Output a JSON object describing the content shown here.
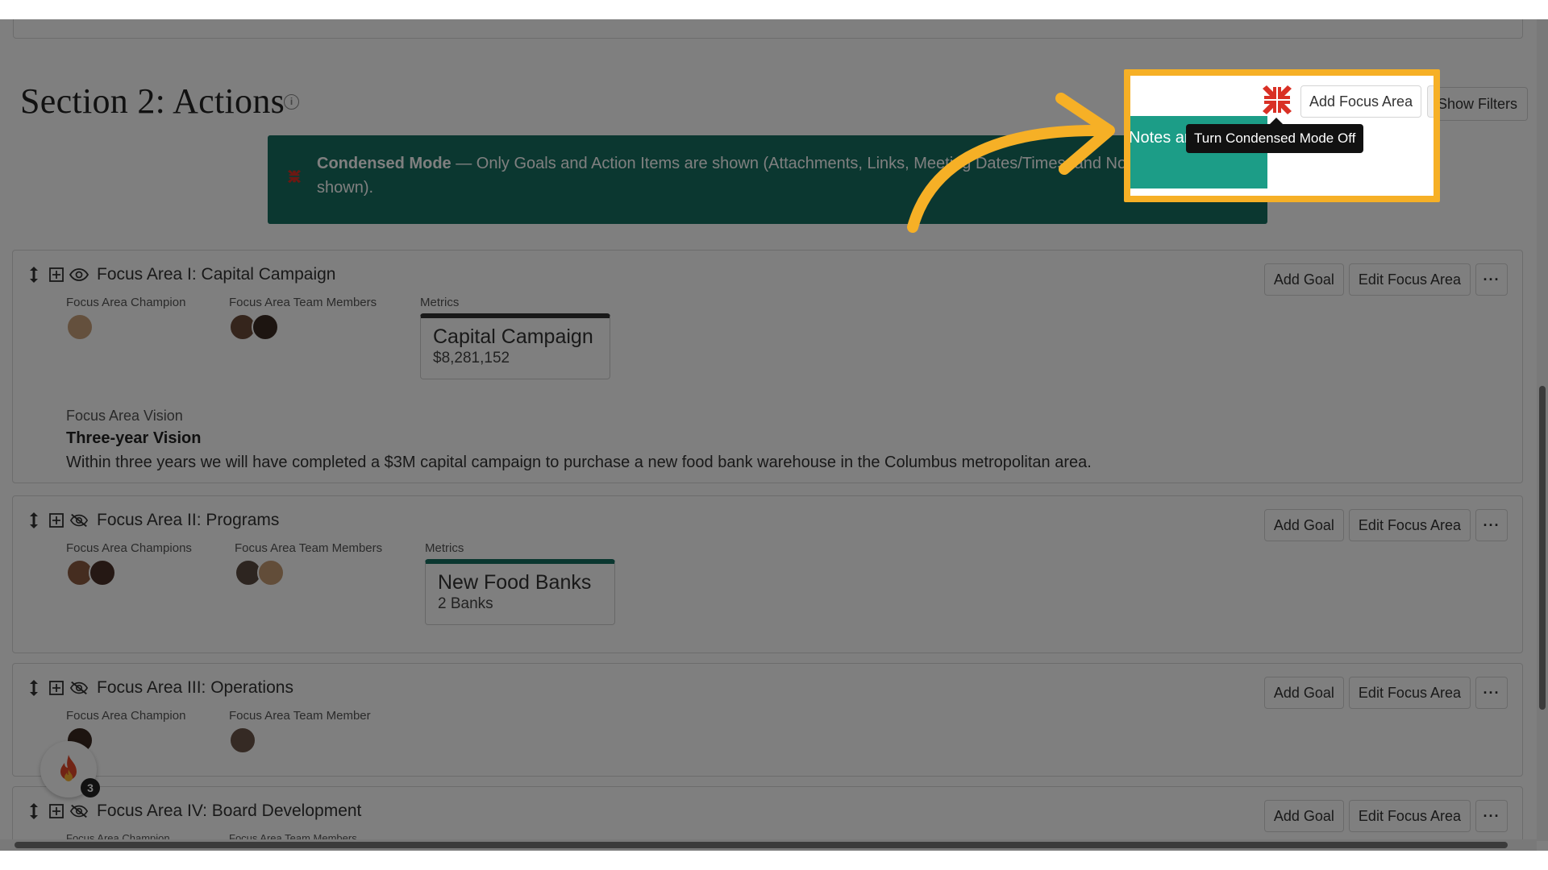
{
  "section": {
    "title": "Section 2: Actions",
    "info_icon": "info-icon"
  },
  "banner": {
    "heading": "Condensed Mode",
    "text": " — Only Goals and Action Items are shown (Attachments, Links, Meeting Dates/Times, and Notes are not shown).",
    "spot_text": "Notes are not"
  },
  "toolbar": {
    "add_focus_area": "Add Focus Area",
    "show_filters": "Show Filters",
    "condensed_toggle_icon": "compress-icon",
    "tooltip": "Turn Condensed Mode Off"
  },
  "focus_areas": [
    {
      "title": "Focus Area I: Capital Campaign",
      "champion_label": "Focus Area Champion",
      "team_label": "Focus Area Team Members",
      "metrics_label": "Metrics",
      "metric_name": "Capital Campaign",
      "metric_value": "$8,281,152",
      "vision_label": "Focus Area Vision",
      "vision_title": "Three-year Vision",
      "vision_text": "Within three years we will have completed a $3M capital campaign to purchase a new food bank warehouse in the Columbus metropolitan area.",
      "visible_icon": "eye-icon"
    },
    {
      "title": "Focus Area II: Programs",
      "champion_label": "Focus Area Champions",
      "team_label": "Focus Area Team Members",
      "metrics_label": "Metrics",
      "metric_name": "New Food Banks",
      "metric_value": "2 Banks",
      "visible_icon": "eye-off-icon"
    },
    {
      "title": "Focus Area III: Operations",
      "champion_label": "Focus Area Champion",
      "team_label": "Focus Area Team Member",
      "visible_icon": "eye-off-icon"
    },
    {
      "title": "Focus Area IV: Board Development",
      "champion_label": "Focus Area Champion",
      "team_label": "Focus Area Team Members",
      "visible_icon": "eye-off-icon"
    }
  ],
  "buttons": {
    "add_goal": "Add Goal",
    "edit_focus_area": "Edit Focus Area",
    "more": "···"
  },
  "notification": {
    "icon": "fire-icon",
    "count": "3"
  },
  "colors": {
    "highlight": "#f6b026",
    "banner": "#176e60",
    "compress_icon": "#d93025"
  }
}
